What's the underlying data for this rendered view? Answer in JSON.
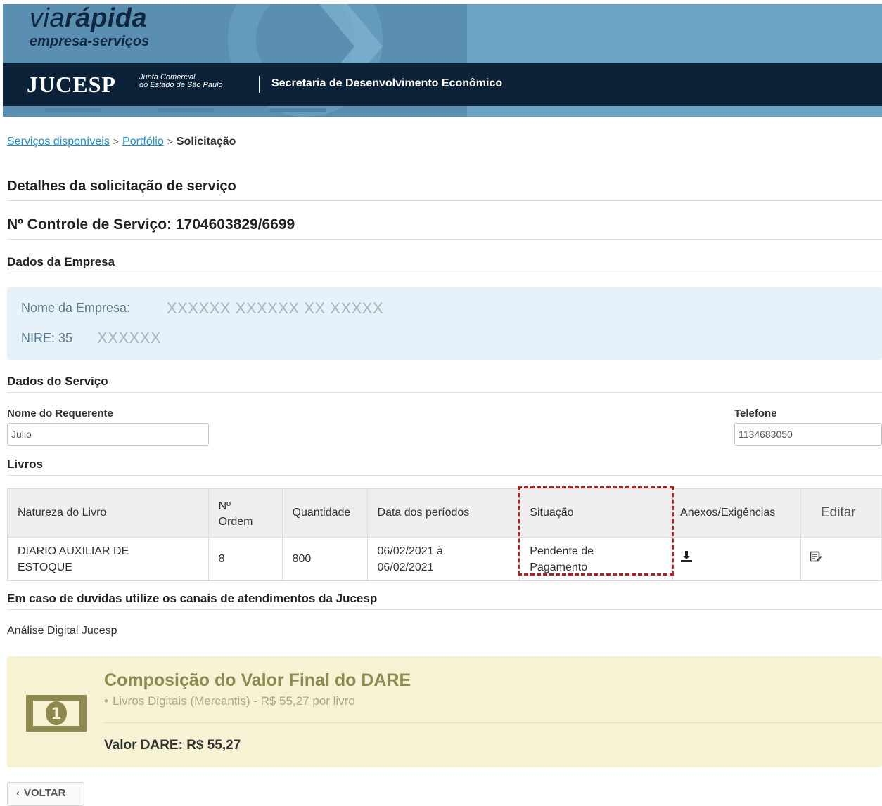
{
  "header": {
    "brand_prefix": "via",
    "brand_bold": "rápida",
    "brand_sub": "empresa-serviços",
    "org_logo": "JUCESP",
    "org_tag_line1": "Junta Comercial",
    "org_tag_line2": "do Estado de São Paulo",
    "gov_text": "Secretaria de Desenvolvimento Econômico"
  },
  "breadcrumb": {
    "items": [
      "Serviços disponíveis",
      "Portfólio"
    ],
    "separator": ">",
    "current": "Solicitação"
  },
  "page": {
    "title": "Detalhes da solicitação de serviço",
    "control_label": "Nº Controle de Serviço: 1704603829/6699"
  },
  "empresa": {
    "section_title": "Dados da Empresa",
    "nome_label": "Nome da Empresa:",
    "nome_value": "XXXXXX XXXXXX XX XXXXX",
    "nire_label": "NIRE: 35",
    "nire_value": "XXXXXX"
  },
  "servico": {
    "section_title": "Dados do Serviço",
    "requerente_label": "Nome do Requerente",
    "requerente_value": "Julio",
    "telefone_label": "Telefone",
    "telefone_value": "1134683050"
  },
  "livros": {
    "section_title": "Livros",
    "columns": [
      "Natureza do Livro",
      "Nº Ordem",
      "Quantidade",
      "Data dos períodos",
      "Situação",
      "Anexos/Exigências",
      "Editar"
    ],
    "column_nordem_line1": "Nº",
    "column_nordem_line2": "Ordem",
    "rows": [
      {
        "natureza_line1": "DIARIO AUXILIAR DE",
        "natureza_line2": "ESTOQUE",
        "ordem": "8",
        "quantidade": "800",
        "data_line1": "06/02/2021 à",
        "data_line2": "06/02/2021",
        "situacao_line1": "Pendente de",
        "situacao_line2": "Pagamento",
        "anexos_icon": "download-icon",
        "editar_icon": "edit-icon"
      }
    ]
  },
  "contato": {
    "section_title": "Em caso de duvidas utilize os canais de atendimentos da Jucesp",
    "text": "Análise Digital Jucesp"
  },
  "dare": {
    "title": "Composição do Valor Final do DARE",
    "bullet": "•",
    "item": "Livros Digitais (Mercantis) - R$ 55,27 por livro",
    "total": "Valor DARE: R$ 55,27",
    "icon": "money-bill-icon"
  },
  "back_button": {
    "chevron": "‹",
    "label": "VOLTAR"
  },
  "colors": {
    "header_bg": "#6aa3c4",
    "gov_bar": "#0c2238",
    "link": "#1d8fd1",
    "highlight": "#b22222",
    "dare_bg": "#f6f2d3",
    "company_bg": "#e6f2fa"
  }
}
